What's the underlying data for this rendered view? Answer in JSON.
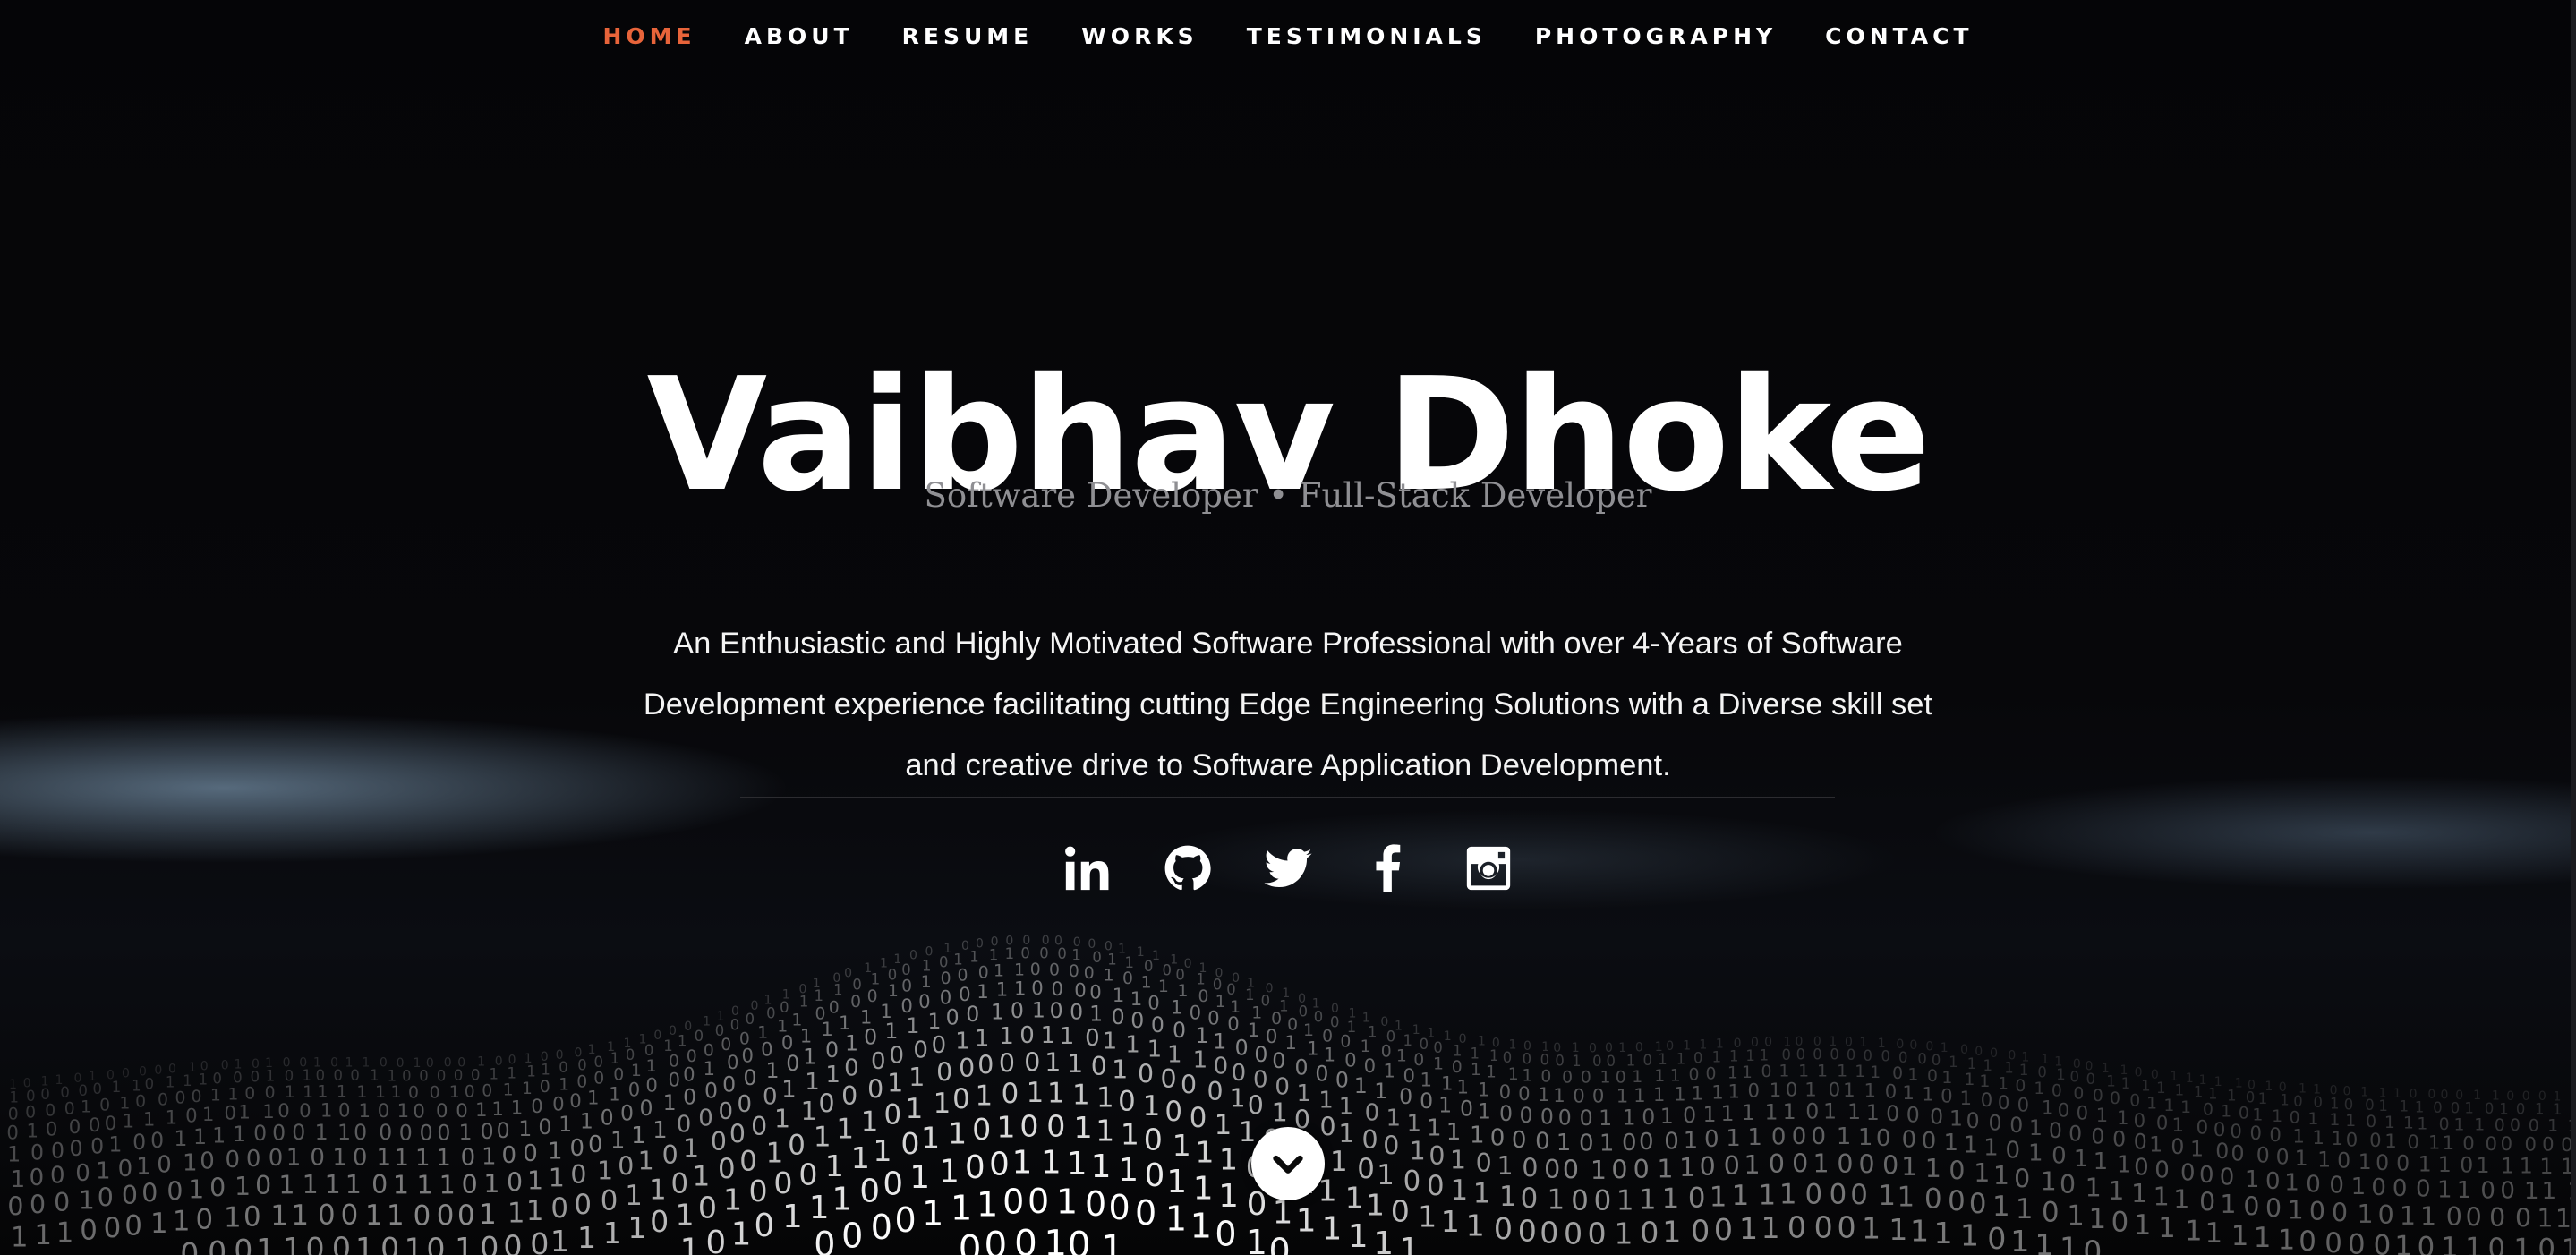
{
  "nav": {
    "items": [
      {
        "label": "HOME",
        "active": true
      },
      {
        "label": "ABOUT",
        "active": false
      },
      {
        "label": "RESUME",
        "active": false
      },
      {
        "label": "WORKS",
        "active": false
      },
      {
        "label": "TESTIMONIALS",
        "active": false
      },
      {
        "label": "PHOTOGRAPHY",
        "active": false
      },
      {
        "label": "CONTACT",
        "active": false
      }
    ],
    "active_color": "#e8643a"
  },
  "hero": {
    "name": "Vaibhav Dhoke",
    "subtitle": "Software Developer • Full-Stack Developer",
    "bio": "An Enthusiastic and Highly Motivated Software Professional with over 4-Years of Software Development experience facilitating cutting Edge Engineering Solutions with a Diverse skill set and creative drive to Software Application Development."
  },
  "social": [
    {
      "icon": "linkedin-icon"
    },
    {
      "icon": "github-icon"
    },
    {
      "icon": "twitter-icon"
    },
    {
      "icon": "facebook-icon"
    },
    {
      "icon": "instagram-icon"
    }
  ],
  "scroll_down": {
    "icon": "chevron-down-icon"
  },
  "background": {
    "style": "binary-wave"
  }
}
